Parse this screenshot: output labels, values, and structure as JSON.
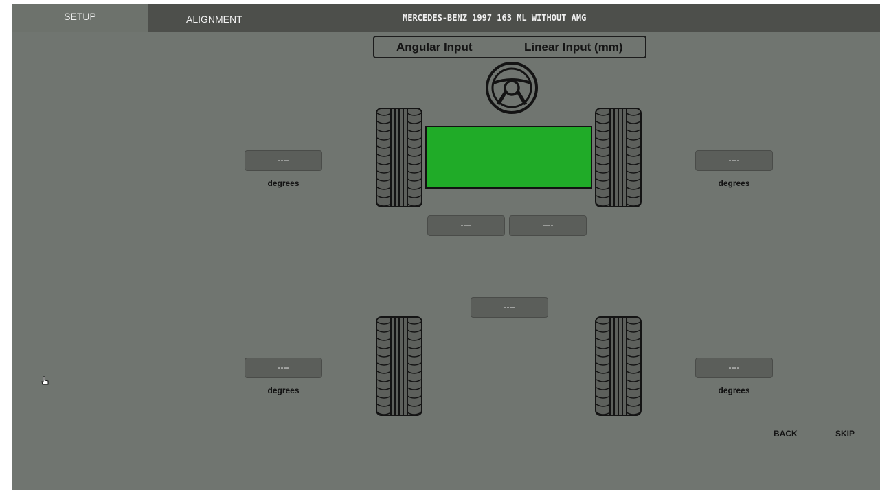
{
  "tabs": [
    {
      "label": "SETUP"
    },
    {
      "label": "ALIGNMENT"
    }
  ],
  "header": {
    "vehicle": "MERCEDES-BENZ 1997 163 ML WITHOUT AMG"
  },
  "mode_toggle": {
    "angular": "Angular Input",
    "linear": "Linear Input (mm)"
  },
  "readings": {
    "front_left": {
      "value": "----",
      "unit": "degrees"
    },
    "front_right": {
      "value": "----",
      "unit": "degrees"
    },
    "rear_left": {
      "value": "----",
      "unit": "degrees"
    },
    "rear_right": {
      "value": "----",
      "unit": "degrees"
    },
    "front_toe_left": {
      "value": "----"
    },
    "front_toe_right": {
      "value": "----"
    },
    "rear_total": {
      "value": "----"
    }
  },
  "nav": {
    "back": "BACK",
    "skip": "SKIP"
  },
  "colors": {
    "chassis": "#20ab28",
    "background": "#707570",
    "topbar": "#4d4f4b"
  },
  "icons": [
    "steering-wheel-icon",
    "tire-icon",
    "hand-cursor-icon"
  ]
}
